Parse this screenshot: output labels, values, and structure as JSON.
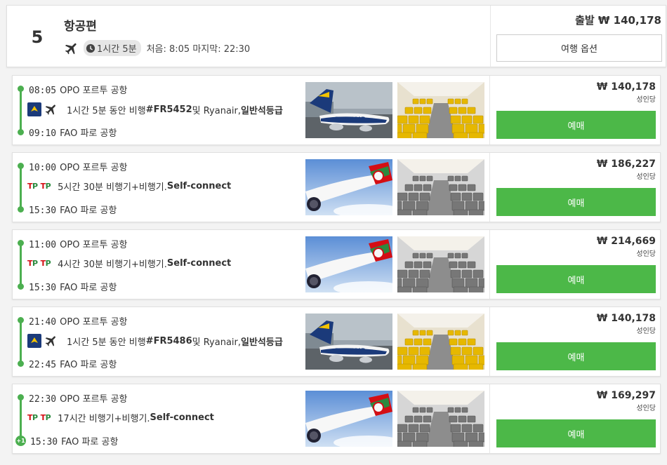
{
  "summary": {
    "count": "5",
    "title": "항공편",
    "duration": "1시간 5분",
    "first_last": "처음: 8:05 마지막: 22:30",
    "price": "출발 ₩ 140,178",
    "trip_options_label": "여행 옵션"
  },
  "flights": [
    {
      "dep_time": "08:05",
      "dep_airport": "OPO 포르투 공항",
      "arr_time": "09:10",
      "arr_airport": "FAO 파로 공항",
      "airline": "ryanair",
      "desc_pre": "1시간 5분 동안 비행 ",
      "flight_no": "#FR5452",
      "desc_mid": " 및 Ryanair, ",
      "cabin": "일반석등급",
      "price": "₩ 140,178",
      "per_adult": "성인당",
      "book_label": "예매"
    },
    {
      "dep_time": "10:00",
      "dep_airport": "OPO 포르투 공항",
      "arr_time": "15:30",
      "arr_airport": "FAO 파로 공항",
      "airline": "tap",
      "desc_pre": "5시간 30분 비행기+비행기. ",
      "connect": "Self-connect",
      "price": "₩ 186,227",
      "per_adult": "성인당",
      "book_label": "예매"
    },
    {
      "dep_time": "11:00",
      "dep_airport": "OPO 포르투 공항",
      "arr_time": "15:30",
      "arr_airport": "FAO 파로 공항",
      "airline": "tap",
      "desc_pre": "4시간 30분 비행기+비행기. ",
      "connect": "Self-connect",
      "price": "₩ 214,669",
      "per_adult": "성인당",
      "book_label": "예매"
    },
    {
      "dep_time": "21:40",
      "dep_airport": "OPO 포르투 공항",
      "arr_time": "22:45",
      "arr_airport": "FAO 파로 공항",
      "airline": "ryanair",
      "desc_pre": "1시간 5분 동안 비행 ",
      "flight_no": "#FR5486",
      "desc_mid": " 및 Ryanair, ",
      "cabin": "일반석등급",
      "price": "₩ 140,178",
      "per_adult": "성인당",
      "book_label": "예매"
    },
    {
      "dep_time": "22:30",
      "dep_airport": "OPO 포르투 공항",
      "arr_time": "15:30",
      "arr_airport": "FAO 파로 공항",
      "airline": "tap",
      "desc_pre": "17시간 비행기+비행기. ",
      "connect": "Self-connect",
      "next_day": "+1",
      "price": "₩ 169,297",
      "per_adult": "성인당",
      "book_label": "예매"
    }
  ],
  "colors": {
    "accent_green": "#4cb848",
    "timeline_green": "#4caf50",
    "ryanair_blue": "#1b3a7a",
    "tap_red": "#d40e14"
  }
}
